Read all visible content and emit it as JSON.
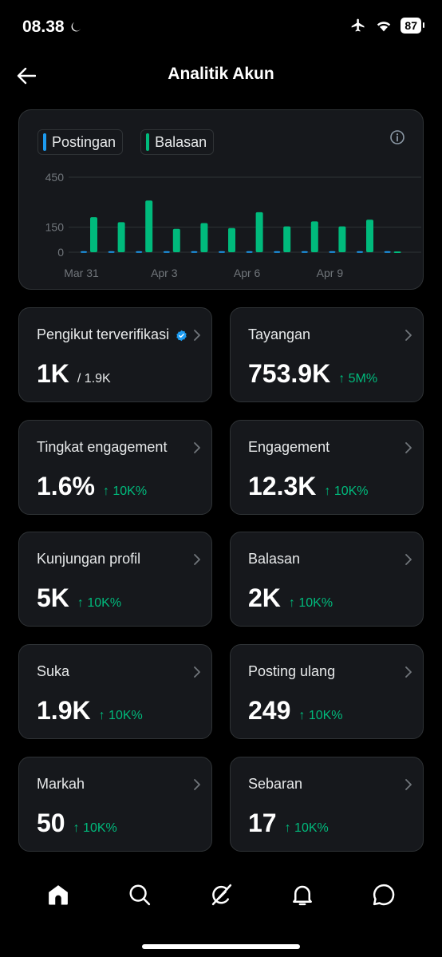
{
  "status_bar": {
    "time": "08.38",
    "battery": "87"
  },
  "header": {
    "title": "Analitik Akun"
  },
  "legend": {
    "posts_label": "Postingan",
    "replies_label": "Balasan",
    "posts_color": "#1d9bf0",
    "replies_color": "#00ba7c"
  },
  "chart_data": {
    "type": "bar",
    "series": [
      {
        "name": "Postingan",
        "values": [
          6,
          6,
          6,
          6,
          6,
          6,
          6,
          6,
          6,
          6,
          6,
          6
        ]
      },
      {
        "name": "Balasan",
        "values": [
          210,
          180,
          310,
          140,
          175,
          145,
          240,
          155,
          185,
          155,
          195,
          5
        ]
      }
    ],
    "x_tick_labels": [
      "Mar 31",
      "Apr 3",
      "Apr 6",
      "Apr 9"
    ],
    "y_tick_labels": [
      "450",
      "150",
      "0"
    ],
    "y_ticks": [
      450,
      150,
      0
    ],
    "ylim": [
      0,
      450
    ],
    "grid": true
  },
  "metrics": [
    {
      "label": "Pengikut terverifikasi",
      "value": "1K",
      "sub": "/ 1.9K",
      "change": "",
      "verified": true
    },
    {
      "label": "Tayangan",
      "value": "753.9K",
      "sub": "",
      "change": "↑ 5M%"
    },
    {
      "label": "Tingkat engagement",
      "value": "1.6%",
      "sub": "",
      "change": "↑ 10K%"
    },
    {
      "label": "Engagement",
      "value": "12.3K",
      "sub": "",
      "change": "↑ 10K%"
    },
    {
      "label": "Kunjungan profil",
      "value": "5K",
      "sub": "",
      "change": "↑ 10K%"
    },
    {
      "label": "Balasan",
      "value": "2K",
      "sub": "",
      "change": "↑ 10K%"
    },
    {
      "label": "Suka",
      "value": "1.9K",
      "sub": "",
      "change": "↑ 10K%"
    },
    {
      "label": "Posting ulang",
      "value": "249",
      "sub": "",
      "change": "↑ 10K%"
    },
    {
      "label": "Markah",
      "value": "50",
      "sub": "",
      "change": "↑ 10K%"
    },
    {
      "label": "Sebaran",
      "value": "17",
      "sub": "",
      "change": "↑ 10K%"
    }
  ],
  "nav": [
    "home-icon",
    "search-icon",
    "grok-icon",
    "bell-icon",
    "message-icon"
  ]
}
